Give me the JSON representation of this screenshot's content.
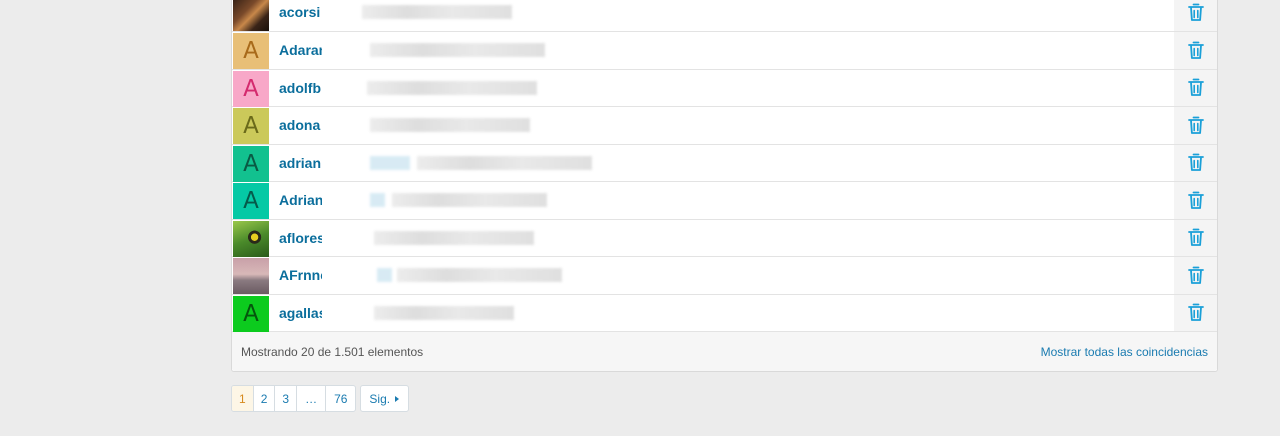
{
  "users": [
    {
      "username": "acorsi",
      "avatar": {
        "type": "photo",
        "letter": "",
        "bg": "#5a3a2a",
        "fg": ""
      }
    },
    {
      "username": "Adaran",
      "avatar": {
        "type": "letter",
        "letter": "A",
        "bg": "#e8bf77",
        "fg": "#a86a1a"
      }
    },
    {
      "username": "adolfb",
      "avatar": {
        "type": "letter",
        "letter": "A",
        "bg": "#f8a8c8",
        "fg": "#d42a6e"
      }
    },
    {
      "username": "adona",
      "avatar": {
        "type": "letter",
        "letter": "A",
        "bg": "#cbc95a",
        "fg": "#6a6a1a"
      }
    },
    {
      "username": "adrian",
      "avatar": {
        "type": "letter",
        "letter": "A",
        "bg": "#12c18f",
        "fg": "#0a5a44"
      }
    },
    {
      "username": "Adrian",
      "avatar": {
        "type": "letter",
        "letter": "A",
        "bg": "#05c9a5",
        "fg": "#055a4a"
      }
    },
    {
      "username": "aflores",
      "avatar": {
        "type": "photo",
        "letter": "",
        "bg": "#6a9a3a",
        "fg": ""
      }
    },
    {
      "username": "AFrnne",
      "avatar": {
        "type": "photo",
        "letter": "",
        "bg": "#b89aa0",
        "fg": ""
      }
    },
    {
      "username": "agallas",
      "avatar": {
        "type": "letter",
        "letter": "A",
        "bg": "#0ccb1e",
        "fg": "#05560d"
      }
    }
  ],
  "footer": {
    "count_text": "Mostrando 20 de 1.501 elementos",
    "show_all_link": "Mostrar todas las coincidencias"
  },
  "pagination": {
    "pages": [
      "1",
      "2",
      "3",
      "…",
      "76"
    ],
    "active_page": "1",
    "next_label": "Sig."
  },
  "colors": {
    "link": "#0b6e9c",
    "trash_icon": "#1aa0d8",
    "active_page_bg": "#fdf6e6",
    "active_page_text": "#d68a1e"
  }
}
